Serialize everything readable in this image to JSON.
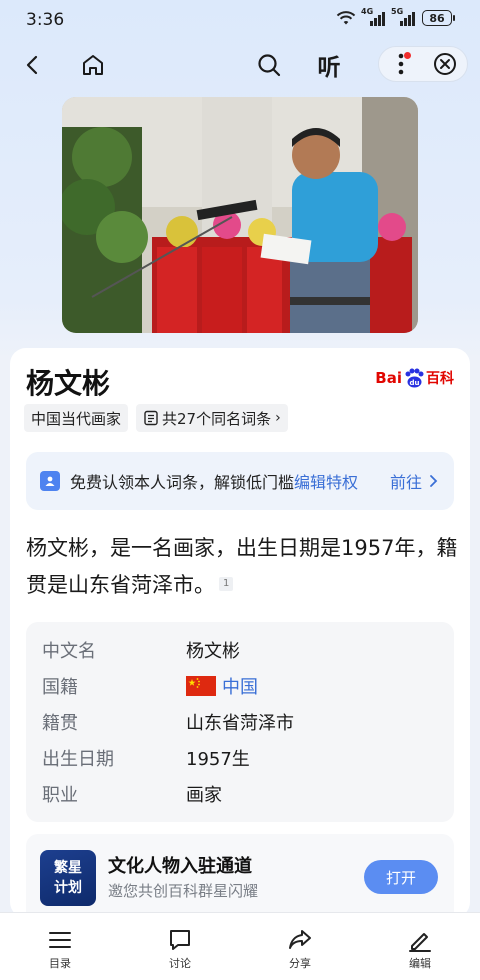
{
  "status": {
    "time": "3:36",
    "net1": "4G",
    "net2": "5G",
    "battery": "86"
  },
  "nav": {
    "listen_label": "听"
  },
  "entry": {
    "title": "杨文彬",
    "tag_category": "中国当代画家",
    "tag_homonym": "共27个同名词条",
    "baidu_logo": {
      "bai": "Bai",
      "du": "du",
      "baike": "百科"
    }
  },
  "claim": {
    "text": "免费认领本人词条，解锁低门槛",
    "link": "编辑特权",
    "go": "前往"
  },
  "summary": {
    "text": "杨文彬，是一名画家，出生日期是1957年，籍贯是山东省菏泽市。",
    "cite": "1"
  },
  "infobox": {
    "rows": [
      {
        "key": "中文名",
        "value": "杨文彬"
      },
      {
        "key": "国籍",
        "value": "中国"
      },
      {
        "key": "籍贯",
        "value": "山东省菏泽市"
      },
      {
        "key": "出生日期",
        "value": "1957生"
      },
      {
        "key": "职业",
        "value": "画家"
      }
    ]
  },
  "promo": {
    "logo_line1": "繁星",
    "logo_line2": "计划",
    "title": "文化人物入驻通道",
    "subtitle": "邀您共创百科群星闪耀",
    "button": "打开"
  },
  "bottom_bar": {
    "items": [
      {
        "label": "目录"
      },
      {
        "label": "讨论"
      },
      {
        "label": "分享"
      },
      {
        "label": "编辑"
      }
    ]
  },
  "colors": {
    "accent": "#3a6fd6",
    "button": "#5b8df2",
    "baidu_red": "#e10601",
    "baidu_blue": "#2932e1"
  }
}
